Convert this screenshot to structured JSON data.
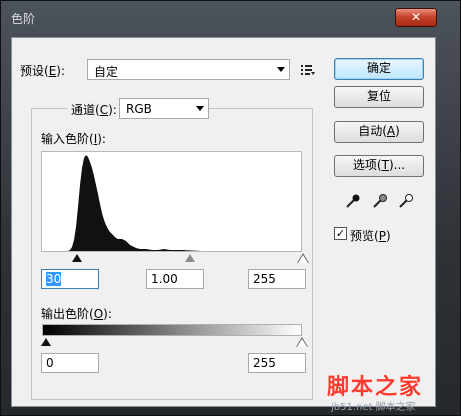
{
  "window": {
    "title": "色阶",
    "close_glyph": "✕"
  },
  "preset": {
    "label": "预设(",
    "accel": "E",
    "label_end": "):",
    "value": "自定",
    "menu_icon": "preset-options-icon"
  },
  "buttons": {
    "ok": "确定",
    "reset": "复位",
    "auto": {
      "label": "自动(",
      "accel": "A",
      "end": ")"
    },
    "options": {
      "label": "选项(",
      "accel": "T",
      "end": ")..."
    }
  },
  "channel": {
    "label": "通道(",
    "accel": "C",
    "label_end": "):",
    "value": "RGB"
  },
  "input_levels": {
    "label": "输入色阶(",
    "accel": "I",
    "label_end": "):",
    "black": "30",
    "gamma": "1.00",
    "white": "255"
  },
  "output_levels": {
    "label": "输出色阶(",
    "accel": "O",
    "label_end": "):",
    "black": "0",
    "white": "255"
  },
  "preview": {
    "label": "预览(",
    "accel": "P",
    "end": ")",
    "checked": true,
    "check_glyph": "✓"
  },
  "watermark": {
    "text": "脚本之家",
    "sub": "jb51.net 脚本之家"
  },
  "colors": {
    "accent": "#3399ff",
    "close": "#c7432c",
    "watermark": "#ff3b2f"
  }
}
